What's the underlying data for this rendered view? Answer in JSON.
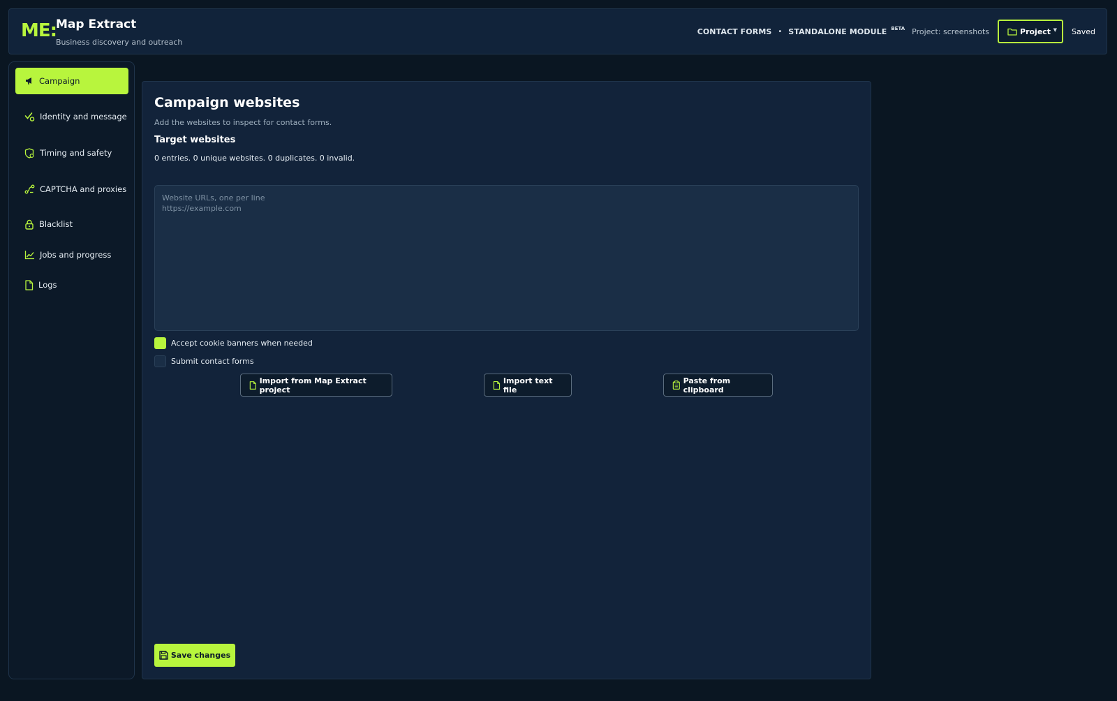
{
  "header": {
    "logo": "ME:",
    "app_title": "Map Extract",
    "app_subtitle": "Business discovery and outreach",
    "module_link_1": "CONTACT FORMS",
    "separator": "•",
    "module_link_2": "STANDALONE MODULE",
    "beta_badge": "BETA",
    "project_label": "Project: screenshots",
    "project_button": "Project",
    "save_status": "Saved"
  },
  "sidebar": {
    "items": [
      {
        "label": "Campaign",
        "icon": "megaphone-icon",
        "active": true
      },
      {
        "label": "Identity and message",
        "icon": "check-badge-icon"
      },
      {
        "label": "Timing and safety",
        "icon": "shield-clock-icon"
      },
      {
        "label": "CAPTCHA and proxies",
        "icon": "route-icon"
      },
      {
        "label": "Blacklist",
        "icon": "lock-icon"
      },
      {
        "label": "Jobs and progress",
        "icon": "line-chart-icon"
      },
      {
        "label": "Logs",
        "icon": "file-icon"
      }
    ]
  },
  "main": {
    "title": "Campaign websites",
    "description": "Add the websites to inspect for contact forms.",
    "section_title": "Target websites",
    "stats": "0 entries. 0 unique websites. 0 duplicates. 0 invalid.",
    "url_input": {
      "value": "",
      "placeholder": "Website URLs, one per line\nhttps://example.com"
    },
    "options": [
      {
        "label": "Accept cookie banners when needed",
        "checked": true
      },
      {
        "label": "Submit contact forms",
        "checked": false
      }
    ],
    "actions": {
      "import_project": "Import from Map Extract project",
      "import_file": "Import text file",
      "paste_clipboard": "Paste from clipboard"
    },
    "save_button": "Save changes"
  },
  "colors": {
    "accent": "#b8f53d",
    "background": "#0a1622",
    "panel": "#12233a"
  }
}
